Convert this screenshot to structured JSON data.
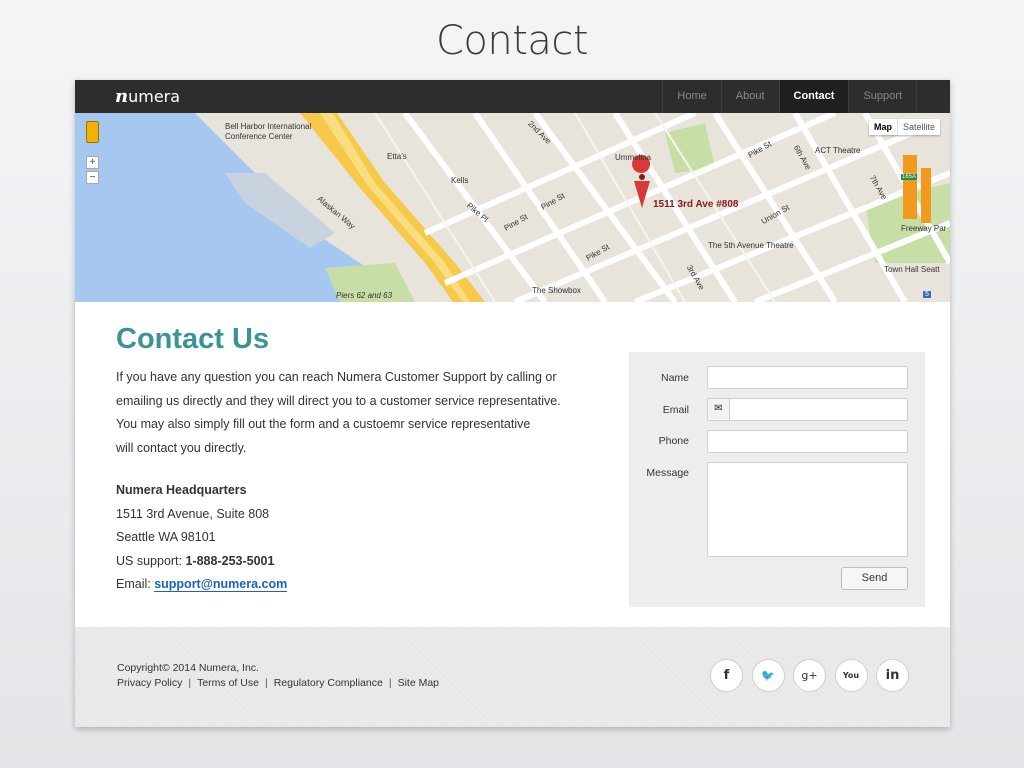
{
  "slide": {
    "title": "Contact"
  },
  "nav": {
    "logo_n": "n",
    "logo_rest": "umera",
    "items": [
      {
        "label": "Home"
      },
      {
        "label": "About"
      },
      {
        "label": "Contact"
      },
      {
        "label": "Support"
      }
    ],
    "active": "Contact"
  },
  "map": {
    "toggle": {
      "map": "Map",
      "satellite": "Satellite"
    },
    "zoom_in": "+",
    "zoom_out": "−",
    "marker_address": "1511 3rd Ave #808",
    "labels": {
      "bell_harbor_1": "Bell Harbor International",
      "bell_harbor_2": "Conference Center",
      "ettas": "Etta's",
      "kells": "Kells",
      "ummelina": "Ummelina",
      "act_theatre": "ACT Theatre",
      "alaskan_way": "Alaskan Way",
      "pike_pl": "Pike Pl",
      "pine_st_1": "Pine St",
      "pine_st_2": "Pine St",
      "second_ave": "2nd Ave",
      "pike_st_1": "Pike St",
      "pike_st_2": "Pike St",
      "sixth_ave": "6th Ave",
      "seventh_ave": "7th Ave",
      "union_st": "Union St",
      "fifth_ave_theatre": "The 5th Avenue Theatre",
      "freeway_park": "Freeway Par",
      "town_hall": "Town Hall Seatt",
      "the_showbox": "The Showbox",
      "piers": "Piers 62 and 63",
      "third_ave": "3rd Ave",
      "highway_1": "165A",
      "highway_2": "5"
    }
  },
  "contact": {
    "heading": "Contact Us",
    "intro_lines": [
      "If you have any question you can reach Numera Customer Support by calling or",
      "emailing us directly and they will direct you to a customer service representative.",
      "You may also  simply fill out the form and a custoemr service representative",
      "will contact you directly."
    ],
    "hq_title": "Numera Headquarters",
    "address_1": "1511 3rd Avenue, Suite 808",
    "address_2": "Seattle WA 98101",
    "support_label": "US support: ",
    "support_phone": "1-888-253-5001",
    "email_label": "Email: ",
    "email": "support@numera.com"
  },
  "form": {
    "name_label": "Name",
    "email_label": "Email",
    "email_icon": "envelope-icon",
    "phone_label": "Phone",
    "message_label": "Message",
    "name_value": "",
    "email_value": "",
    "phone_value": "",
    "message_value": "",
    "send_label": "Send"
  },
  "footer": {
    "copyright": "Copyright© 2014 Numera, Inc.",
    "links": [
      "Privacy Policy",
      "Terms of Use",
      "Regulatory Compliance",
      "Site Map"
    ],
    "social": [
      {
        "icon": "facebook-icon",
        "glyph": "f"
      },
      {
        "icon": "twitter-icon",
        "glyph": "🐦"
      },
      {
        "icon": "google-plus-icon",
        "glyph": "g+"
      },
      {
        "icon": "youtube-icon",
        "glyph": "You"
      },
      {
        "icon": "linkedin-icon",
        "glyph": "in"
      }
    ]
  },
  "colors": {
    "heading": "#3a9496",
    "navbar": "#2d2d2d",
    "link": "#1a62c0",
    "water": "#a5c7f0",
    "park": "#c7dfa6",
    "highway": "#f6c94a"
  }
}
